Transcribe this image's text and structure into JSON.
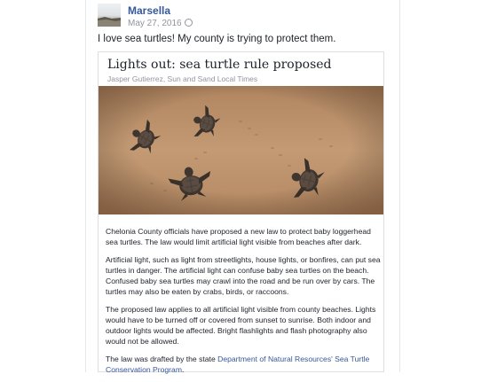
{
  "post": {
    "author": "Marsella",
    "date": "May 27, 2016",
    "privacy_icon": "globe-icon",
    "text": "I love sea turtles! My county is trying to protect them."
  },
  "article": {
    "headline": "Lights out: sea turtle rule proposed",
    "byline": "Jasper Gutierrez, Sun and Sand Local Times",
    "image_subject": "sea turtle hatchlings crawling on sand",
    "paragraphs": [
      "Chelonia County officials have proposed a new law to protect baby loggerhead sea turtles. The law would limit artificial light visible from beaches after dark.",
      "Artificial light, such as light from streetlights, house lights, or bonfires, can put sea turtles in danger. The artificial light can confuse baby sea turtles on the beach. Confused baby sea turtles may crawl into the road and be run over by cars. The turtles may also be eaten by crabs, birds, or raccoons.",
      "The proposed law applies to all artificial light visible from county beaches. Lights would have to be turned off or covered from sunset to sunrise. Both indoor and outdoor lights would be affected. Bright flashlights and flash photography also would not be allowed."
    ],
    "last_prefix": "The law was drafted by the state ",
    "last_link": "Department of Natural Resources' Sea Turtle Conservation Program",
    "last_suffix": "."
  },
  "colors": {
    "link": "#365899",
    "meta": "#90949c",
    "text": "#1d2129"
  }
}
